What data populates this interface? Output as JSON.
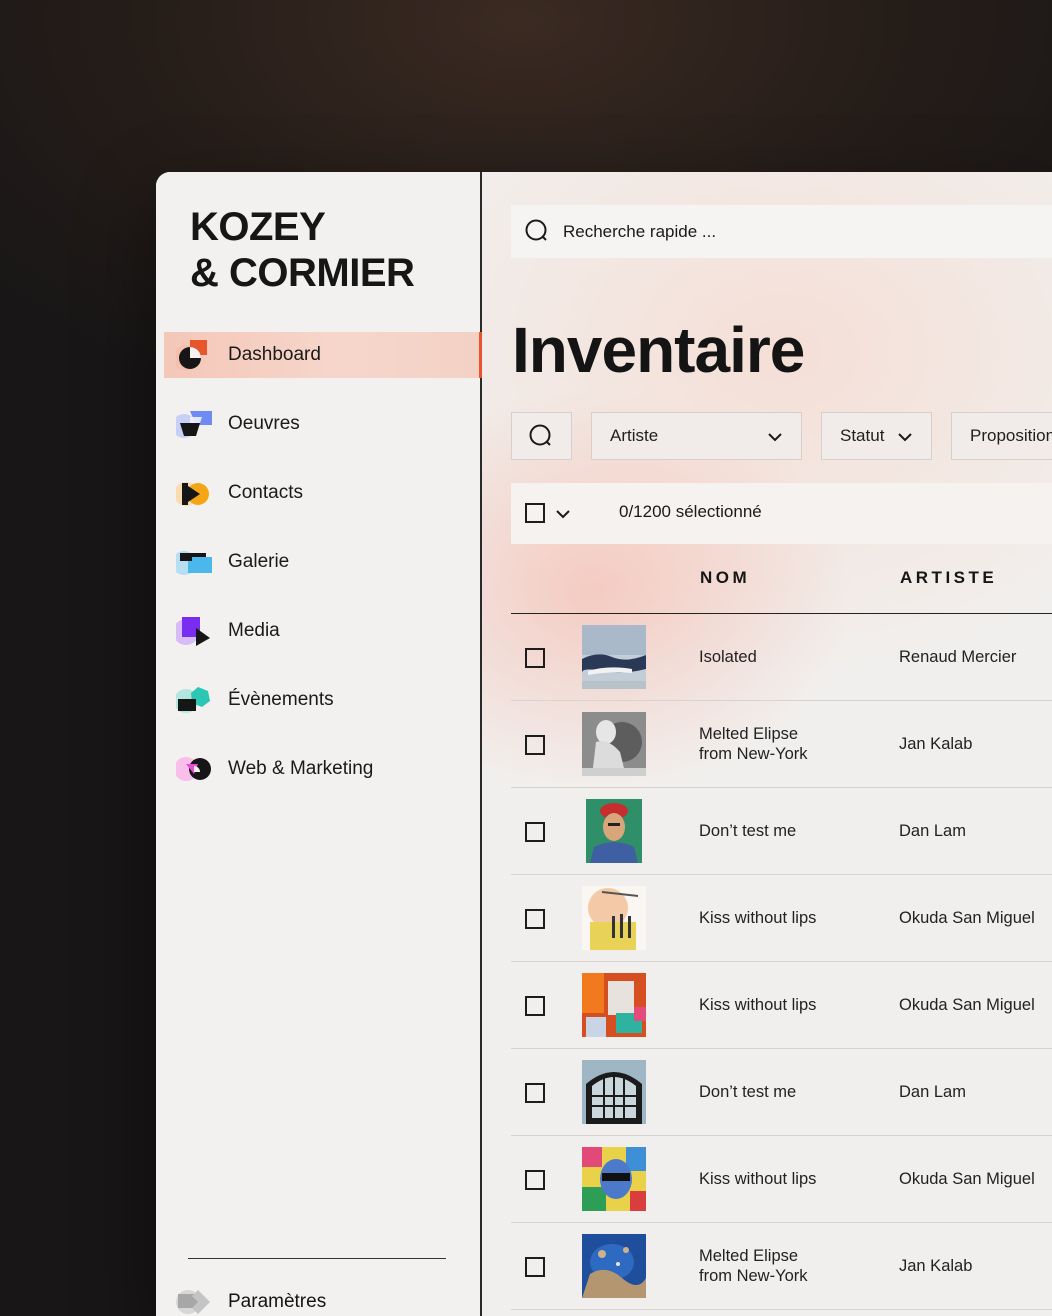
{
  "brand": {
    "line1": "KOZEY",
    "line2": "& CORMIER"
  },
  "sidebar": {
    "items": [
      {
        "label": "Dashboard",
        "icon": "dashboard-icon",
        "active": true
      },
      {
        "label": "Oeuvres",
        "icon": "oeuvres-icon"
      },
      {
        "label": "Contacts",
        "icon": "contacts-icon"
      },
      {
        "label": "Galerie",
        "icon": "galerie-icon"
      },
      {
        "label": "Media",
        "icon": "media-icon"
      },
      {
        "label": "Évènements",
        "icon": "evenements-icon"
      },
      {
        "label": "Web & Marketing",
        "icon": "web-marketing-icon"
      }
    ],
    "settings_label": "Paramètres"
  },
  "search": {
    "placeholder": "Recherche rapide ..."
  },
  "page": {
    "title": "Inventaire"
  },
  "filters": {
    "artist": "Artiste",
    "status": "Statut",
    "proposition": "Proposition"
  },
  "selection": {
    "count": "0/1200 sélectionné"
  },
  "table": {
    "columns": [
      "NOM",
      "ARTISTE"
    ],
    "rows": [
      {
        "name": "Isolated",
        "artist": "Renaud Mercier"
      },
      {
        "name": "Melted Elipse\nfrom New-York",
        "artist": "Jan Kalab"
      },
      {
        "name": "Don’t test me",
        "artist": "Dan Lam"
      },
      {
        "name": "Kiss without lips",
        "artist": "Okuda San Miguel"
      },
      {
        "name": "Kiss without lips",
        "artist": "Okuda San Miguel"
      },
      {
        "name": "Don’t test me",
        "artist": "Dan Lam"
      },
      {
        "name": "Kiss without lips",
        "artist": "Okuda San Miguel"
      },
      {
        "name": "Melted Elipse\nfrom New-York",
        "artist": "Jan Kalab"
      }
    ]
  },
  "colors": {
    "accent": "#e8542c",
    "active_bg": "#f4c7b8",
    "text": "#141414"
  }
}
